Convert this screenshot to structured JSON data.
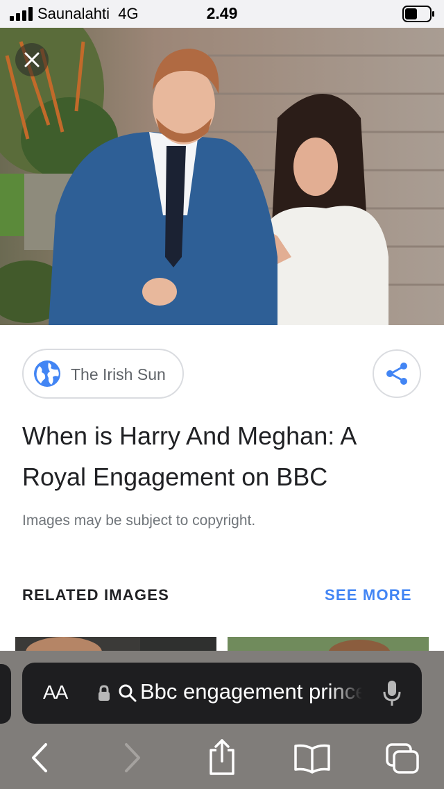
{
  "status_bar": {
    "carrier": "Saunalahti",
    "network": "4G",
    "time": "2.49",
    "signal_bars": 4,
    "battery_level": 0.5
  },
  "hero": {
    "close_icon": "close-icon",
    "colors": {
      "sky_stone": "#a89488",
      "suit": "#2e5f96",
      "coat": "#f1f0ec",
      "hair_dark": "#2b1d18",
      "hair_red": "#b06a42",
      "skin": "#e8b89c",
      "foliage": "#4f7035"
    }
  },
  "source": {
    "label": "The Irish Sun",
    "icon": "globe-icon",
    "accent": "#4285f4"
  },
  "share": {
    "icon": "share-icon"
  },
  "title": {
    "line1": "When is Harry And Meghan: A",
    "line2": "Royal Engagement on BBC"
  },
  "copyright": "Images may be subject to copyright.",
  "related": {
    "heading": "RELATED IMAGES",
    "see_more": "SEE MORE"
  },
  "toolbar": {
    "text_size_label": "AA",
    "lock_icon": "lock-icon",
    "search_icon": "search-icon",
    "url_text": "Bbc engagement prince",
    "mic_icon": "microphone-icon",
    "nav_icons": [
      "back-arrow-icon",
      "forward-arrow-icon",
      "share-icon",
      "bookmarks-icon",
      "tabs-icon"
    ]
  }
}
